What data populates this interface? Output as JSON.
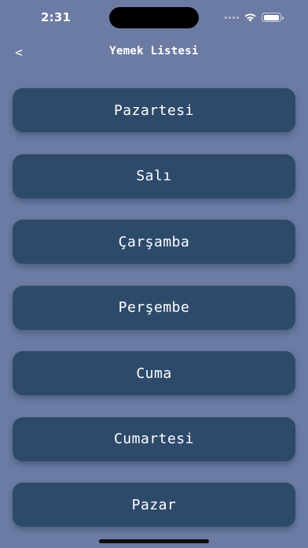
{
  "status_bar": {
    "time": "2:31"
  },
  "nav": {
    "back_label": "<",
    "title": "Yemek Listesi"
  },
  "days": [
    {
      "label": "Pazartesi"
    },
    {
      "label": "Salı"
    },
    {
      "label": "Çarşamba"
    },
    {
      "label": "Perşembe"
    },
    {
      "label": "Cuma"
    },
    {
      "label": "Cumartesi"
    },
    {
      "label": "Pazar"
    }
  ],
  "colors": {
    "background": "#6b7ba3",
    "button": "#2d4a6b",
    "text": "#ffffff"
  },
  "icons": [
    "signal-icon",
    "wifi-icon",
    "battery-icon",
    "back-chevron-icon"
  ]
}
